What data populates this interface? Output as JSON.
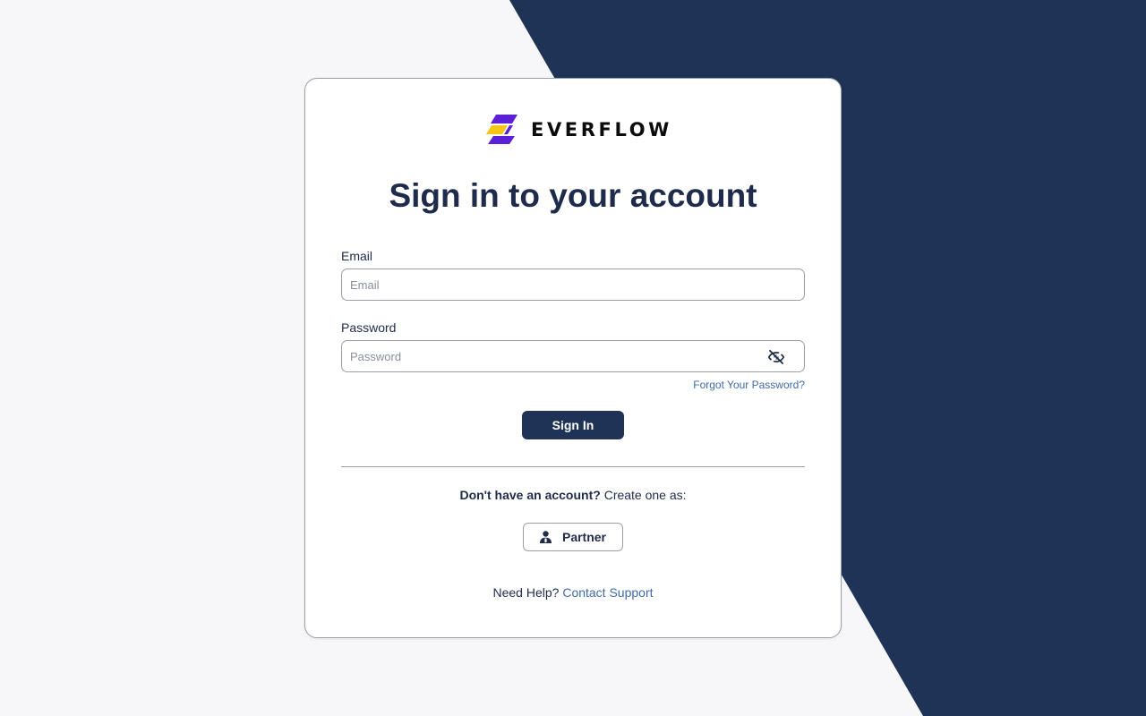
{
  "brand": {
    "name": "EVERFLOW",
    "logo_colors": {
      "purple": "#5a1fd6",
      "yellow": "#f5c518"
    }
  },
  "page": {
    "title": "Sign in to your account"
  },
  "form": {
    "email_label": "Email",
    "email_placeholder": "Email",
    "email_value": "",
    "password_label": "Password",
    "password_placeholder": "Password",
    "password_value": "",
    "password_toggle_icon": "eye-off-icon",
    "forgot_link": "Forgot Your Password?",
    "submit_label": "Sign In"
  },
  "signup": {
    "prompt_bold": "Don't have an account?",
    "prompt_rest": " Create one as:",
    "partner_label": "Partner",
    "partner_icon": "user-tie-icon"
  },
  "help": {
    "prefix": "Need Help? ",
    "link": "Contact Support"
  },
  "colors": {
    "navy": "#1f3357",
    "text": "#1e2b4a",
    "link": "#3f6aa8",
    "page_bg": "#f7f7f9",
    "border": "#9aa0aa"
  }
}
